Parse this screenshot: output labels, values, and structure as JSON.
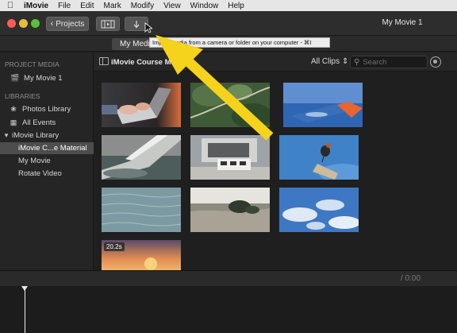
{
  "menubar": {
    "apple_icon": "apple-icon",
    "items": [
      "iMovie",
      "File",
      "Edit",
      "Mark",
      "Modify",
      "View",
      "Window",
      "Help"
    ]
  },
  "toolbar": {
    "projects_label": "Projects",
    "window_title": "My Movie 1"
  },
  "tabs": {
    "my_media_label": "My Media",
    "tooltip": "Import media from a camera or folder on your computer - ⌘I"
  },
  "sidebar": {
    "project_media_heading": "PROJECT MEDIA",
    "project_item": "My Movie 1",
    "libraries_heading": "LIBRARIES",
    "photos_library": "Photos Library",
    "all_events": "All Events",
    "imovie_library": "iMovie Library",
    "library_items": [
      "iMovie C...e Material",
      "My Movie",
      "Rotate Video"
    ]
  },
  "browser": {
    "library_title": "iMovie Course Material",
    "filter_label": "All Clips",
    "search_placeholder": "Search",
    "clip_badge": "20.2s"
  },
  "timeline": {
    "timecode": "/ 0:00"
  },
  "colors": {
    "annotation_arrow": "#f5d21b",
    "selection": "#4d4d4d",
    "traffic_red": "#fc5b57",
    "traffic_yellow": "#e5bf3c",
    "traffic_green": "#57c038"
  }
}
